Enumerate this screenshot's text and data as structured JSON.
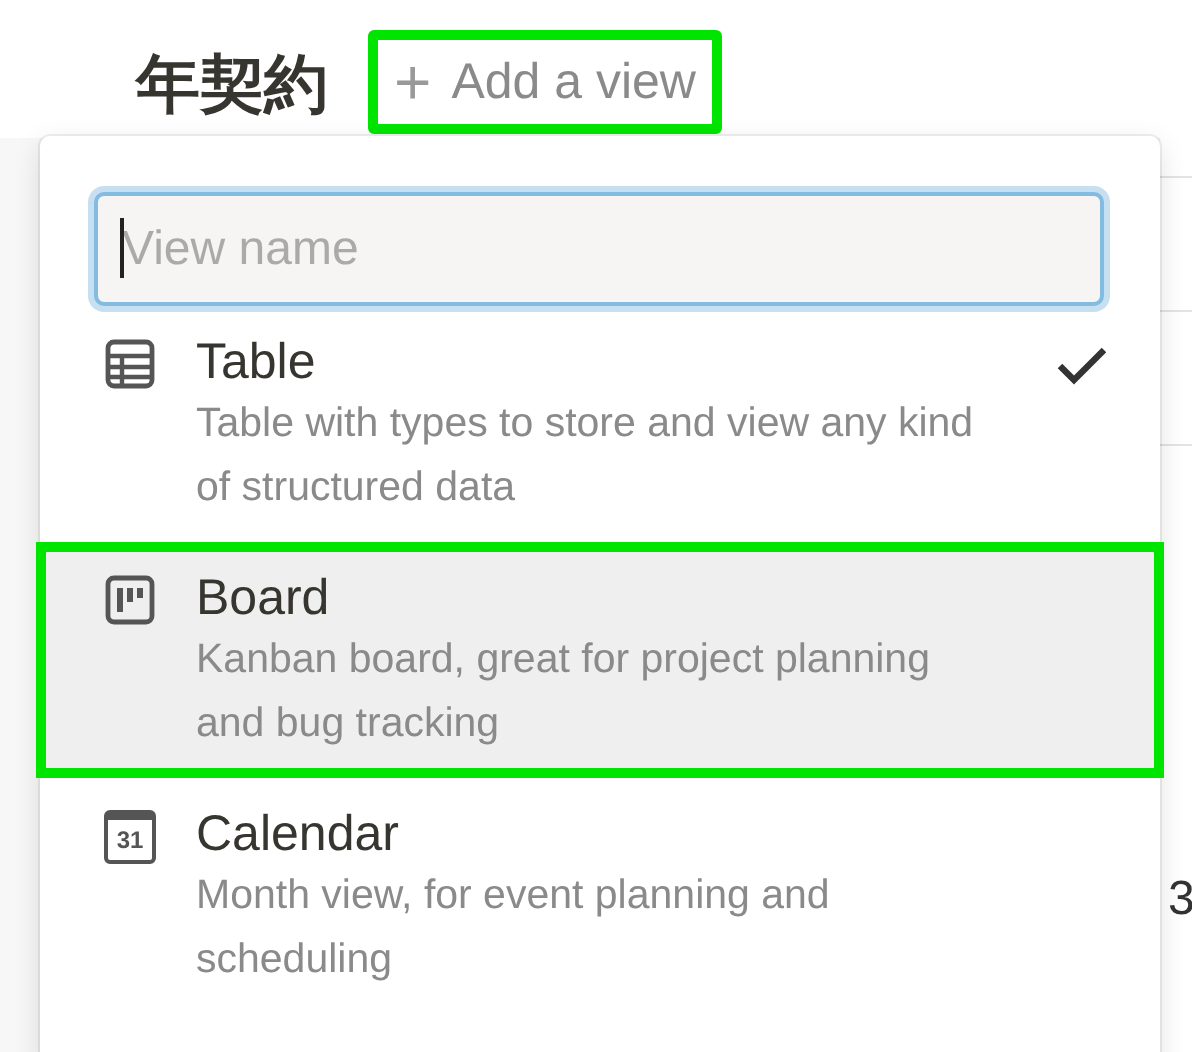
{
  "page": {
    "title": "年契約",
    "add_view": {
      "icon": "+",
      "label": "Add a view",
      "highlighted": true
    },
    "background_fragment": "3"
  },
  "menu": {
    "search": {
      "placeholder": "View name",
      "focused": true
    },
    "items": [
      {
        "kind": "table",
        "title": "Table",
        "description": "Table with types to store and view any kind of structured data",
        "selected": true,
        "hovered": false,
        "highlighted": false
      },
      {
        "kind": "board",
        "title": "Board",
        "description": "Kanban board, great for project planning and bug tracking",
        "selected": false,
        "hovered": true,
        "highlighted": true
      },
      {
        "kind": "calendar",
        "title": "Calendar",
        "description": "Month view, for event planning and scheduling",
        "icon_label": "31",
        "selected": false,
        "hovered": false,
        "highlighted": false
      }
    ]
  }
}
